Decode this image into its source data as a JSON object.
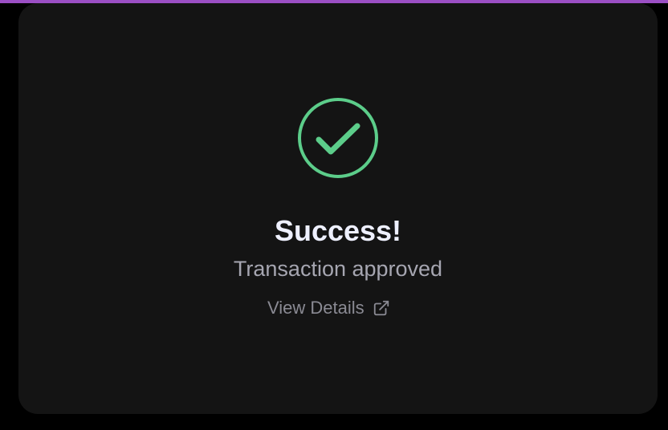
{
  "colors": {
    "accent_bar": "#9b4fc4",
    "success_green": "#5ccd8a",
    "card_bg": "#141414",
    "title": "#eef0ff",
    "subtitle": "#a6a6b1",
    "link": "#8a8a93"
  },
  "status": {
    "icon": "check-circle-icon",
    "title": "Success!",
    "message": "Transaction approved"
  },
  "link": {
    "label": "View Details",
    "icon": "external-link-icon"
  }
}
